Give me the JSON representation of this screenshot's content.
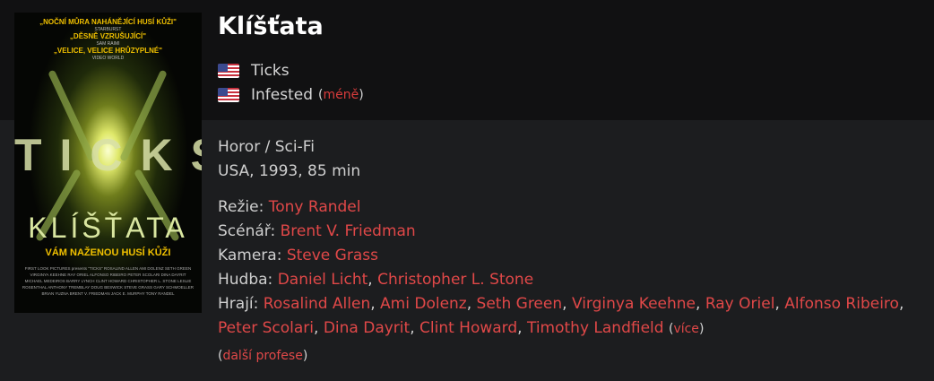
{
  "movie": {
    "title": "Klíšťata",
    "alt_titles": [
      {
        "flag": "us-flag-icon",
        "name": "Ticks"
      },
      {
        "flag": "us-flag-icon",
        "name": "Infested"
      }
    ],
    "less_label": "méně",
    "genre": "Horor / Sci-Fi",
    "origin": "USA, 1993, 85 min"
  },
  "poster": {
    "quote1": "„NOČNÍ MŮRA NAHÁNĚJÍCÍ HUSÍ KŮŽI\"",
    "src1": "STARBURST",
    "quote2": "„DĚSNĚ VZRUŠUJÍCÍ\"",
    "src2": "SAM RAIMI",
    "quote3": "„VELICE, VELICE HRŮZYPLNÉ\"",
    "src3": "VIDEO WORLD",
    "big_title": "TICKS",
    "cz_title": "KLÍŠŤATA",
    "tagline": "VÁM NAŽENOU HUSÍ KŮŽI",
    "credits": "FIRST LOOK PICTURES presents \"TICKS\" ROSALIND ALLEN AMI DOLENZ SETH GREEN VIRGINYA KEEHNE RAY ORIEL ALFONSO RIBEIRO PETER SCOLARI DINA DAYRIT MICHAEL MEDEIROS BARRY LYNCH CLINT HOWARD CHRISTOPHER L. STONE LESLIE ROSENTHAL ANTHONY TREMBLAY DOUG BESWICK STEVE GRASS GARY SCHMOELLER BRIAN YUZNA BRENT V. FRIEDMAN JACK E. MURPHY TONY RANDEL"
  },
  "crew": {
    "director_label": "Režie:",
    "director": "Tony Randel",
    "writer_label": "Scénář:",
    "writer": "Brent V. Friedman",
    "camera_label": "Kamera:",
    "camera": "Steve Grass",
    "music_label": "Hudba:",
    "music": [
      "Daniel Licht",
      "Christopher L. Stone"
    ],
    "cast_label": "Hrají:",
    "cast": [
      "Rosalind Allen",
      "Ami Dolenz",
      "Seth Green",
      "Virginya Keehne",
      "Ray Oriel",
      "Alfonso Ribeiro",
      "Peter Scolari",
      "Dina Dayrit",
      "Clint Howard",
      "Timothy Landfield"
    ],
    "more_label": "více",
    "other_professions_label": "další profese"
  },
  "colors": {
    "link": "#e04848",
    "background": "#1c1d1f",
    "header_band": "#111112"
  }
}
